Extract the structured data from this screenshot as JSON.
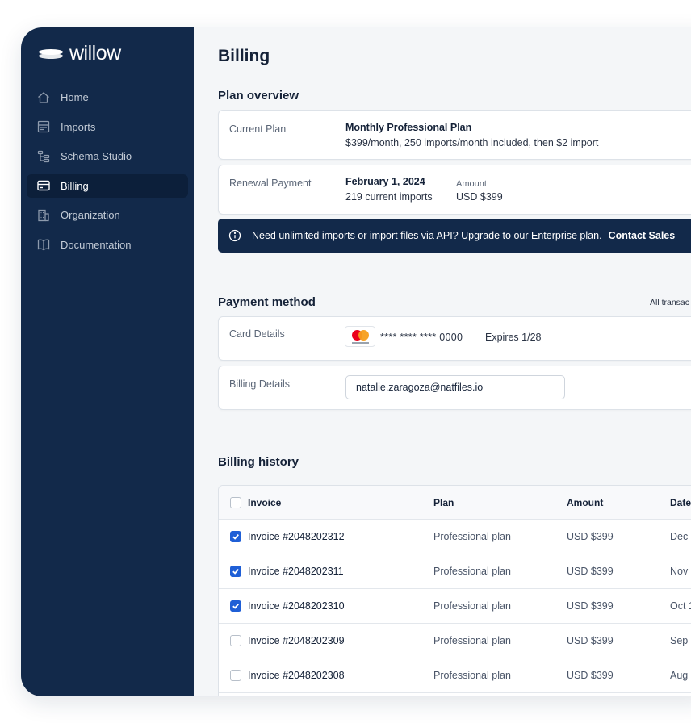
{
  "brand": {
    "name": "willow"
  },
  "sidebar": {
    "items": [
      {
        "label": "Home",
        "icon": "home-icon",
        "active": false
      },
      {
        "label": "Imports",
        "icon": "imports-icon",
        "active": false
      },
      {
        "label": "Schema Studio",
        "icon": "schema-icon",
        "active": false
      },
      {
        "label": "Billing",
        "icon": "credit-card-icon",
        "active": true
      },
      {
        "label": "Organization",
        "icon": "building-icon",
        "active": false
      },
      {
        "label": "Documentation",
        "icon": "book-icon",
        "active": false
      }
    ]
  },
  "page": {
    "title": "Billing"
  },
  "plan_overview": {
    "title": "Plan overview",
    "current_plan": {
      "label": "Current Plan",
      "name": "Monthly Professional Plan",
      "description": "$399/month, 250 imports/month included, then $2 import"
    },
    "renewal": {
      "label": "Renewal Payment",
      "date": "February 1, 2024",
      "imports": "219 current imports",
      "amount_label": "Amount",
      "amount": "USD $399"
    },
    "banner": {
      "text": "Need unlimited imports or import files via API? Upgrade to our Enterprise plan.",
      "link": "Contact Sales"
    }
  },
  "payment_method": {
    "title": "Payment method",
    "all_transactions": "All transac",
    "card": {
      "label": "Card Details",
      "brand_icon": "mastercard-icon",
      "number": "**** **** **** 0000",
      "expiry": "Expires 1/28"
    },
    "billing": {
      "label": "Billing Details",
      "email": "natalie.zaragoza@natfiles.io"
    }
  },
  "billing_history": {
    "title": "Billing history",
    "columns": {
      "invoice": "Invoice",
      "plan": "Plan",
      "amount": "Amount",
      "date": "Date"
    },
    "rows": [
      {
        "invoice": "Invoice #2048202312",
        "plan": "Professional plan",
        "amount": "USD $399",
        "date": "Dec",
        "checked": true
      },
      {
        "invoice": "Invoice #2048202311",
        "plan": "Professional plan",
        "amount": "USD $399",
        "date": "Nov",
        "checked": true
      },
      {
        "invoice": "Invoice #2048202310",
        "plan": "Professional plan",
        "amount": "USD $399",
        "date": "Oct 1",
        "checked": true
      },
      {
        "invoice": "Invoice #2048202309",
        "plan": "Professional plan",
        "amount": "USD $399",
        "date": "Sep",
        "checked": false
      },
      {
        "invoice": "Invoice #2048202308",
        "plan": "Professional plan",
        "amount": "USD $399",
        "date": "Aug",
        "checked": false
      }
    ]
  },
  "colors": {
    "sidebar": "#12294a",
    "sidebar_active": "#0c1f3a",
    "background": "#f4f6f8",
    "accent": "#1f5fd6"
  }
}
